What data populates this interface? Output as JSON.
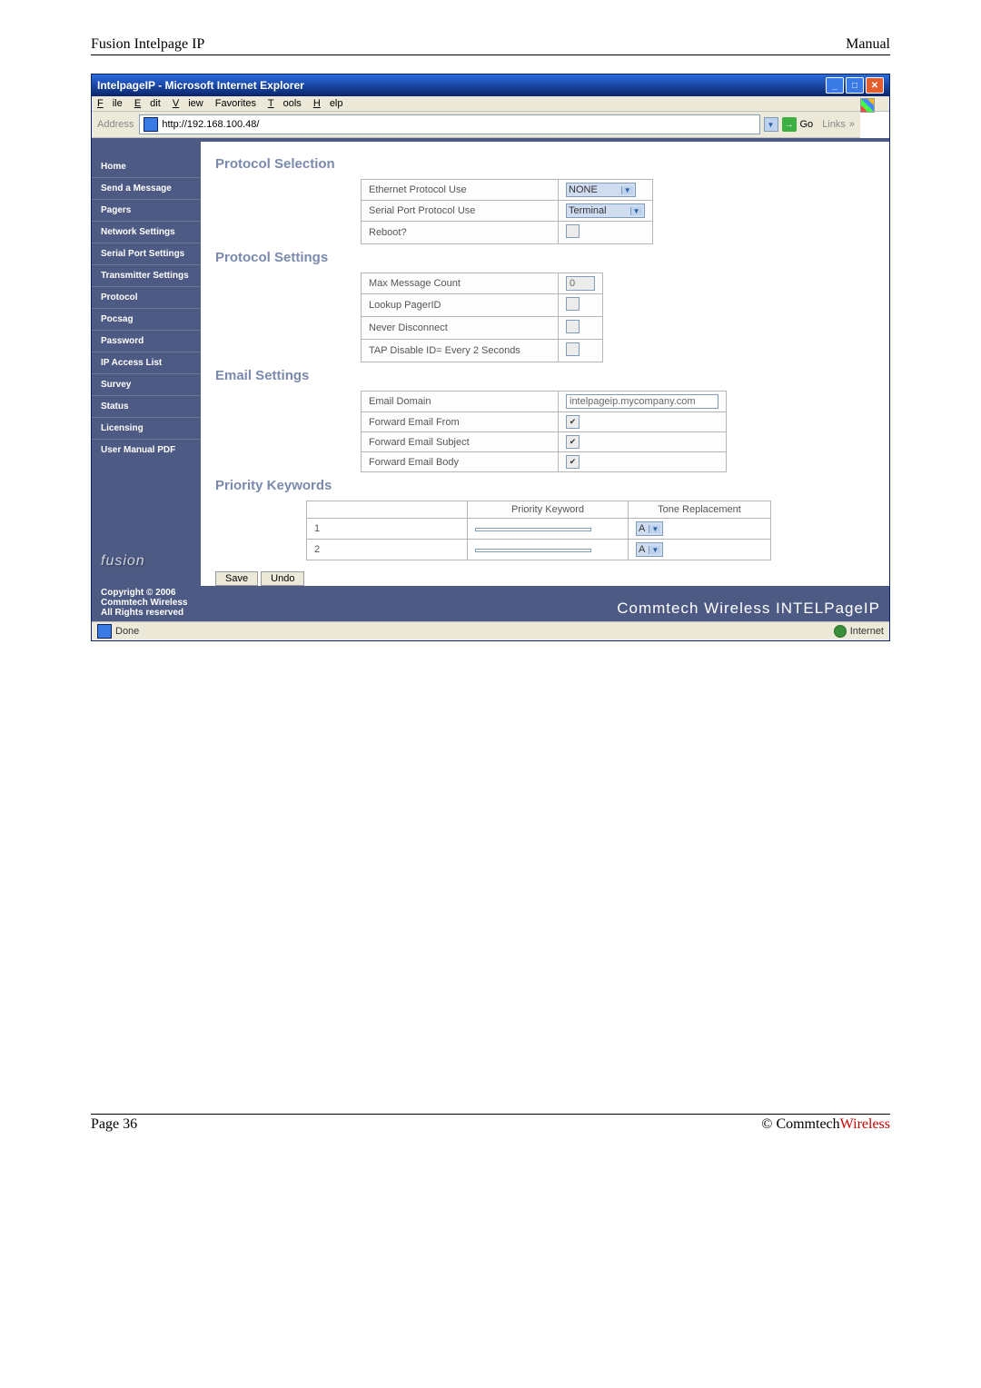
{
  "doc_header": {
    "left": "Fusion Intelpage IP",
    "right": "Manual"
  },
  "doc_footer": {
    "left": "Page 36",
    "right_pre": "© Commtech",
    "right_red": "Wireless"
  },
  "window": {
    "title": "IntelpageIP - Microsoft Internet Explorer",
    "menus": [
      {
        "u": "F",
        "rest": "ile"
      },
      {
        "u": "E",
        "rest": "dit"
      },
      {
        "u": "V",
        "rest": "iew"
      },
      {
        "u": "",
        "rest": "Favorites",
        "full": "Favorites",
        "no_u": true,
        "text": "Favorites"
      },
      {
        "u": "T",
        "rest": "ools"
      },
      {
        "u": "H",
        "rest": "elp"
      }
    ],
    "favorites": "Favorites",
    "address_label": "Address",
    "address_value": "http://192.168.100.48/",
    "go": "Go",
    "links": "Links"
  },
  "sidebar": {
    "items": [
      "Home",
      "Send a Message",
      "Pagers",
      "Network Settings",
      "Serial Port Settings",
      "Transmitter Settings",
      "Protocol",
      "Pocsag",
      "Password",
      "IP Access List",
      "Survey",
      "Status",
      "Licensing",
      "User Manual PDF"
    ],
    "logo": "fusion"
  },
  "sections": {
    "protocol_selection": {
      "title": "Protocol Selection",
      "rows": [
        {
          "label": "Ethernet Protocol Use",
          "type": "select",
          "value": "NONE"
        },
        {
          "label": "Serial Port Protocol Use",
          "type": "select",
          "value": "Terminal"
        },
        {
          "label": "Reboot?",
          "type": "check",
          "checked": false
        }
      ]
    },
    "protocol_settings": {
      "title": "Protocol Settings",
      "rows": [
        {
          "label": "Max Message Count",
          "type": "text",
          "value": "0"
        },
        {
          "label": "Lookup PagerID",
          "type": "check",
          "checked": false
        },
        {
          "label": "Never Disconnect",
          "type": "check",
          "checked": false
        },
        {
          "label": "TAP Disable ID= Every 2 Seconds",
          "type": "check",
          "checked": false
        }
      ]
    },
    "email_settings": {
      "title": "Email Settings",
      "rows": [
        {
          "label": "Email Domain",
          "type": "longtext",
          "value": "intelpageip.mycompany.com"
        },
        {
          "label": "Forward Email From",
          "type": "check",
          "checked": true
        },
        {
          "label": "Forward Email Subject",
          "type": "check",
          "checked": true
        },
        {
          "label": "Forward Email Body",
          "type": "check",
          "checked": true
        }
      ]
    },
    "priority_keywords": {
      "title": "Priority Keywords",
      "headers": [
        "",
        "Priority Keyword",
        "Tone Replacement"
      ],
      "rows": [
        {
          "n": "1",
          "kw": "",
          "tone": "A"
        },
        {
          "n": "2",
          "kw": "",
          "tone": "A"
        }
      ]
    }
  },
  "buttons": {
    "save": "Save",
    "undo": "Undo"
  },
  "footer": {
    "copyright": "Copyright © 2006\nCommtech Wireless\nAll Rights reserved",
    "brand": "Commtech Wireless INTELPageIP"
  },
  "statusbar": {
    "done": "Done",
    "zone": "Internet"
  }
}
